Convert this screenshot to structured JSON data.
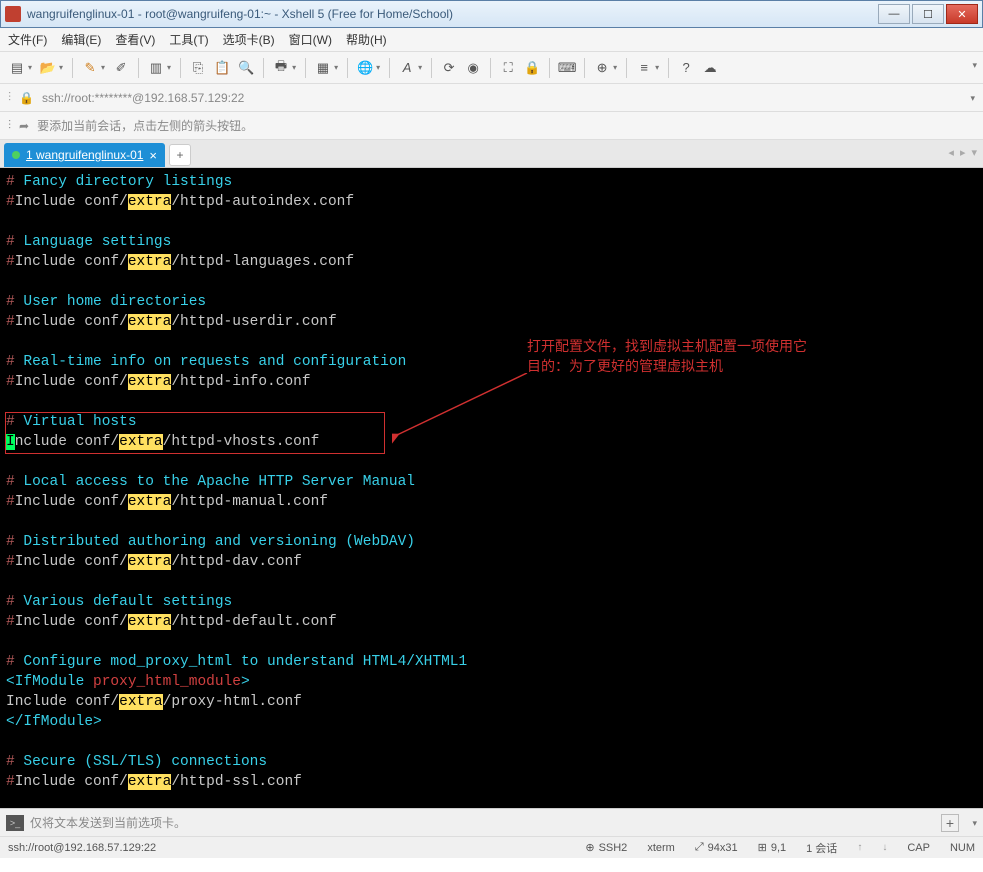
{
  "window_title": "wangruifenglinux-01 - root@wangruifeng-01:~ - Xshell 5 (Free for Home/School)",
  "menu": {
    "file": "文件(F)",
    "edit": "编辑(E)",
    "view": "查看(V)",
    "tools": "工具(T)",
    "tab": "选项卡(B)",
    "window": "窗口(W)",
    "help": "帮助(H)"
  },
  "address": "ssh://root:********@192.168.57.129:22",
  "hint_text": "要添加当前会话，点击左侧的箭头按钮。",
  "tab_label": "1 wangruifenglinux-01",
  "term": {
    "l1_cmt": " Fancy directory listings",
    "l2_a": "Include conf/",
    "l2_b": "/httpd-autoindex.conf",
    "l3_cmt": " Language settings",
    "l4_b": "/httpd-languages.conf",
    "l5_cmt": " User home directories",
    "l6_b": "/httpd-userdir.conf",
    "l7_cmt": " Real-time info on requests and configuration",
    "l8_b": "/httpd-info.conf",
    "l9_cmt": " Virtual hosts",
    "l10_a": "nclude conf/",
    "l10_b": "/httpd-vhosts.conf",
    "l11_cmt": " Local access to the Apache HTTP Server Manual",
    "l12_b": "/httpd-manual.conf",
    "l13_cmt": " Distributed authoring and versioning (WebDAV)",
    "l14_b": "/httpd-dav.conf",
    "l15_cmt": " Various default settings",
    "l16_b": "/httpd-default.conf",
    "l17_cmt": " Configure mod_proxy_html to understand HTML4/XHTML1",
    "l18_a": "IfModule ",
    "l18_b": "proxy_html_module",
    "l19_a": "Include conf/",
    "l19_b": "/proxy-html.conf",
    "l20": "IfModule",
    "l21_cmt": " Secure (SSL/TLS) connections",
    "l22_b": "/httpd-ssl.conf",
    "extra": "extra",
    "hash": "#"
  },
  "annotation": {
    "line1": "打开配置文件，找到虚拟主机配置一项使用它",
    "line2": "目的：为了更好的管理虚拟主机"
  },
  "input_placeholder": "仅将文本发送到当前选项卡。",
  "status": {
    "conn": "ssh://root@192.168.57.129:22",
    "proto": "SSH2",
    "term": "xterm",
    "size": "94x31",
    "pos": "9,1",
    "sess": "1 会话",
    "cap": "CAP",
    "num": "NUM"
  }
}
